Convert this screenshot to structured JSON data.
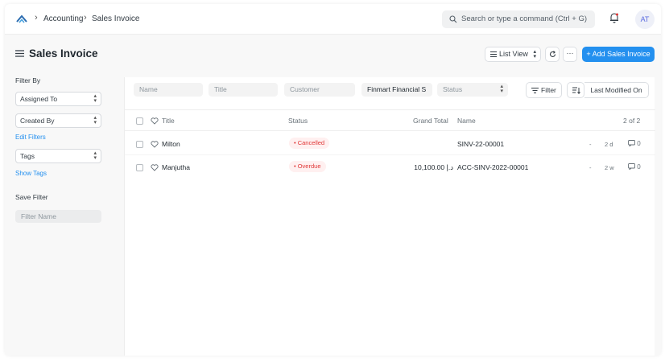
{
  "navbar": {
    "breadcrumbs": [
      "Accounting",
      "Sales Invoice"
    ],
    "search_placeholder": "Search or type a command (Ctrl + G)",
    "avatar_initials": "AT"
  },
  "page": {
    "title": "Sales Invoice",
    "view_label": "List View",
    "more_label": "···",
    "add_label": "+ Add Sales Invoice"
  },
  "sidebar": {
    "filter_by": "Filter By",
    "assigned_to": "Assigned To",
    "created_by": "Created By",
    "edit_filters": "Edit Filters",
    "tags": "Tags",
    "show_tags": "Show Tags",
    "save_filter": "Save Filter",
    "filter_name_placeholder": "Filter Name"
  },
  "filters": {
    "name_placeholder": "Name",
    "title_placeholder": "Title",
    "customer_placeholder": "Customer",
    "company_value": "Finmart Financial S",
    "status_placeholder": "Status",
    "filter_label": "Filter",
    "sort_label": "Last Modified On"
  },
  "table": {
    "headers": {
      "title": "Title",
      "status": "Status",
      "grand_total": "Grand Total",
      "name": "Name"
    },
    "count": "2 of 2",
    "rows": [
      {
        "title": "Milton",
        "status": "Cancelled",
        "grand_total": "",
        "name": "SINV-22-00001",
        "dash": "-",
        "age": "2 d",
        "comments": "0"
      },
      {
        "title": "Manjutha",
        "status": "Overdue",
        "grand_total": "10,100.00 د.إ",
        "name": "ACC-SINV-2022-00001",
        "dash": "-",
        "age": "2 w",
        "comments": "0"
      }
    ]
  },
  "colors": {
    "primary": "#2490ef",
    "status_red": "#e03636",
    "status_red_bg": "#fff0f0"
  }
}
